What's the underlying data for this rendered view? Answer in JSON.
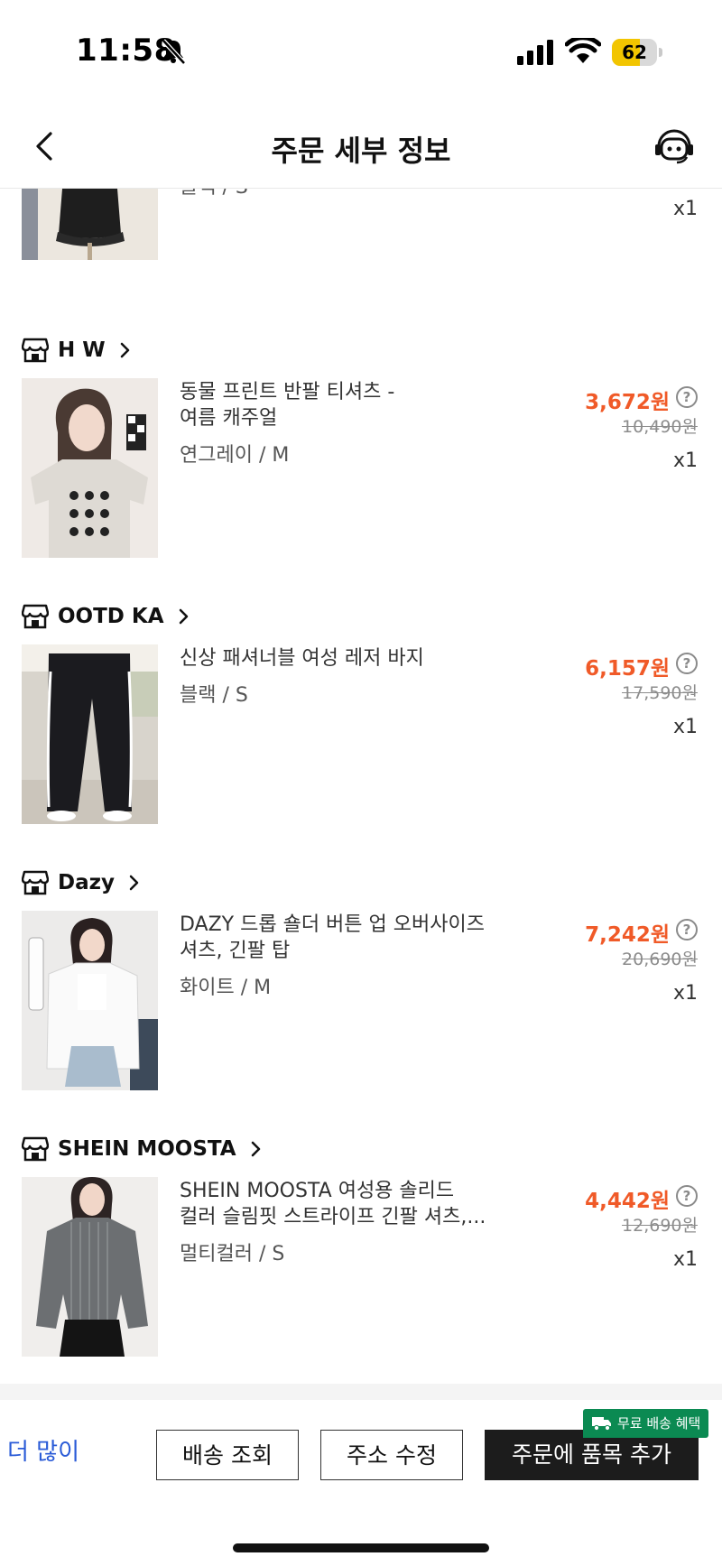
{
  "status_bar": {
    "time": "11:58",
    "battery": "62",
    "battery_level": 0.62
  },
  "nav": {
    "title": "주문 세부 정보"
  },
  "items": [
    {
      "store": "",
      "name": "",
      "variant": "블랙 / S",
      "price": "",
      "original_price": "",
      "qty": "x1"
    },
    {
      "store": "H W",
      "name_line1": "동물 프린트 반팔 티셔츠 -",
      "name_line2": "여름 캐주얼",
      "variant": "연그레이 / M",
      "price": "3,672원",
      "original_price": "10,490원",
      "qty": "x1"
    },
    {
      "store": "OOTD KA",
      "name_line1": "신상 패셔너블 여성 레저 바지",
      "name_line2": "",
      "variant": "블랙 / S",
      "price": "6,157원",
      "original_price": "17,590원",
      "qty": "x1"
    },
    {
      "store": "Dazy",
      "name_line1": "DAZY 드롭 숄더 버튼 업 오버사이즈",
      "name_line2": "셔츠, 긴팔 탑",
      "variant": "화이트 / M",
      "price": "7,242원",
      "original_price": "20,690원",
      "qty": "x1"
    },
    {
      "store": "SHEIN MOOSTA",
      "name_line1": "SHEIN MOOSTA 여성용 솔리드",
      "name_line2": "컬러 슬림핏 스트라이프 긴팔 셔츠,...",
      "variant": "멀티컬러 / S",
      "price": "4,442원",
      "original_price": "12,690원",
      "qty": "x1"
    }
  ],
  "bottom": {
    "more": "더 많이",
    "track_label": "배송 조회",
    "edit_address_label": "주소 수정",
    "add_items_label": "주문에 품목 추가",
    "badge": "무료 배송 혜택"
  },
  "colors": {
    "price": "#f05a28",
    "badge": "#0b8a52",
    "link": "#2a5bd7",
    "dark_button": "#1c1c1c"
  },
  "icons": [
    "bell-slash-icon",
    "signal-icon",
    "wifi-icon",
    "battery-icon",
    "back-arrow-icon",
    "support-robot-icon",
    "store-icon",
    "chevron-right-icon",
    "help-icon",
    "truck-icon"
  ]
}
